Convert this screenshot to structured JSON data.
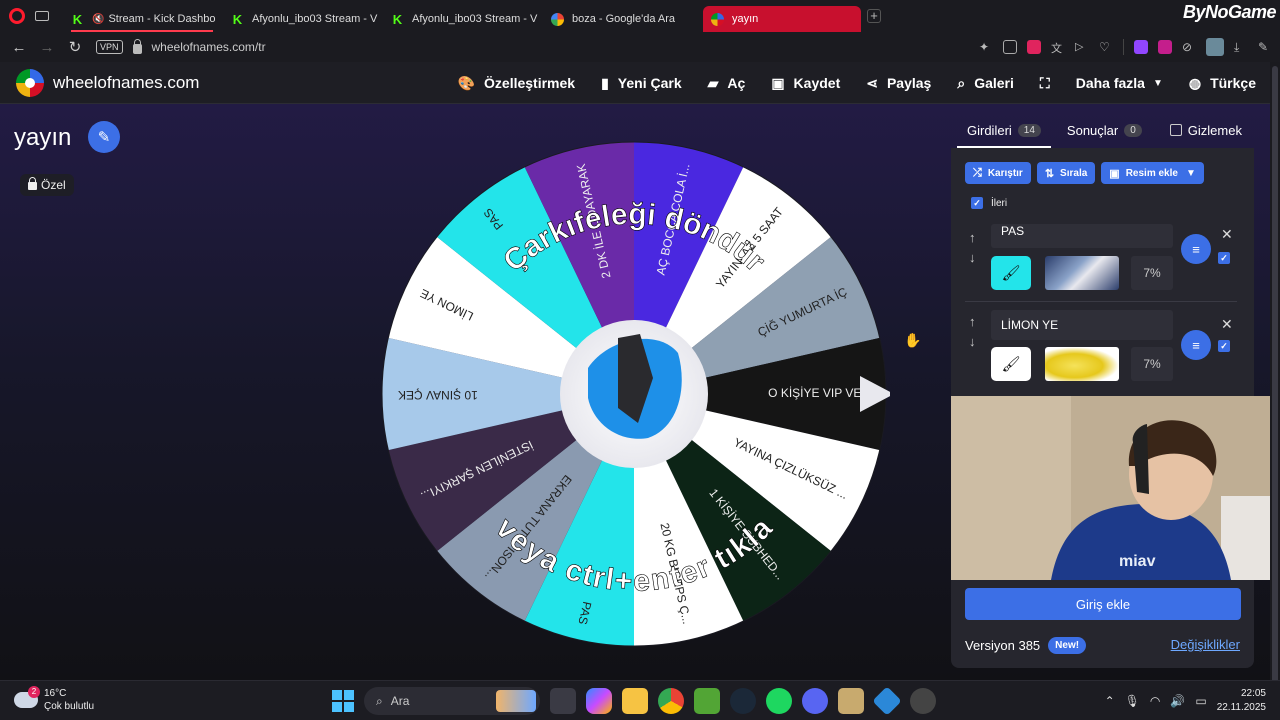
{
  "browser": {
    "tabs": [
      {
        "label": "Stream - Kick Dashbo",
        "favicon": "kick-icon",
        "muted": true,
        "active": false
      },
      {
        "label": "Afyonlu_ibo03 Stream - V",
        "favicon": "kick-icon",
        "muted": false,
        "active": false
      },
      {
        "label": "Afyonlu_ibo03 Stream - V",
        "favicon": "kick-icon",
        "muted": false,
        "active": false
      },
      {
        "label": "boza - Google'da Ara",
        "favicon": "google-icon",
        "muted": false,
        "active": false
      },
      {
        "label": "yayın",
        "favicon": "wheelofnames-icon",
        "muted": false,
        "active": true
      }
    ],
    "brand_overlay": "ByNoGame",
    "vpn_label": "VPN",
    "url": "wheelofnames.com/tr"
  },
  "site": {
    "name": "wheelofnames.com",
    "nav": [
      {
        "label": "Özelleştirmek",
        "icon": "palette-icon"
      },
      {
        "label": "Yeni Çark",
        "icon": "file-icon"
      },
      {
        "label": "Aç",
        "icon": "folder-icon"
      },
      {
        "label": "Kaydet",
        "icon": "save-icon"
      },
      {
        "label": "Paylaş",
        "icon": "share-icon"
      },
      {
        "label": "Galeri",
        "icon": "search-icon"
      },
      {
        "label": "",
        "icon": "fullscreen-icon"
      },
      {
        "label": "Daha fazla",
        "icon": ""
      },
      {
        "label": "Türkçe",
        "icon": "globe-icon"
      }
    ]
  },
  "wheel": {
    "title": "yayın",
    "privacy_label": "Özel",
    "instruction_top": "Çarkıfeleği döndür",
    "instruction_bottom": "veya ctrl+enter tıkla",
    "segments": [
      {
        "label": "AÇ BOCCA COLA İ...",
        "color": "#4a28e0"
      },
      {
        "label": "YAYINI AZ 5 SAAT",
        "color": "#ffffff"
      },
      {
        "label": "ÇİĞ YUMURTA İÇ",
        "color": "#8fa0b2"
      },
      {
        "label": "O KİŞİYE VIP VER",
        "color": "#151515"
      },
      {
        "label": "YAYINA ÇIZLÜKSÜZ ...",
        "color": "#ffffff"
      },
      {
        "label": "1 KİŞİYE SUBHED...",
        "color": "#0c2416"
      },
      {
        "label": "20 KG BICEPS Ç...",
        "color": "#ffffff"
      },
      {
        "label": "PAS",
        "color": "#23e4ea"
      },
      {
        "label": "EKRANA TUT ... ISON...",
        "color": "#8a9ab0"
      },
      {
        "label": "İSTENİLEN ŞARKIYI...",
        "color": "#3a2a48"
      },
      {
        "label": "10 ŞINAV ÇEK",
        "color": "#a7c9ea"
      },
      {
        "label": "LİMON YE",
        "color": "#ffffff"
      },
      {
        "label": "PAS",
        "color": "#23e4ea"
      },
      {
        "label": "2 DK İLE LİDAYARAK",
        "color": "#6a2aa8"
      }
    ]
  },
  "panel": {
    "tabs": [
      {
        "label": "Girdileri",
        "count": "14",
        "active": true
      },
      {
        "label": "Sonuçlar",
        "count": "0",
        "active": false
      }
    ],
    "hide_label": "Gizlemek",
    "buttons": [
      {
        "label": "Karıştır",
        "icon": "shuffle-icon"
      },
      {
        "label": "Sırala",
        "icon": "sort-icon"
      },
      {
        "label": "Resim ekle",
        "icon": "image-icon"
      }
    ],
    "advanced_label": "İleri",
    "advanced_checked": true,
    "entries": [
      {
        "name": "PAS",
        "color": "#23e4ea",
        "percent": "7%",
        "enabled": true
      },
      {
        "name": "LİMON YE",
        "color": "#ffffff",
        "percent": "7%",
        "enabled": true
      }
    ],
    "add_label": "Giriş ekle",
    "version_label": "Versiyon 385",
    "new_badge": "New!",
    "changes_label": "Değişiklikler"
  },
  "taskbar": {
    "weather_temp": "16°C",
    "weather_desc": "Çok bulutlu",
    "weather_badge": "2",
    "search_label": "Ara",
    "time": "22:05",
    "date": "22.11.2025"
  }
}
